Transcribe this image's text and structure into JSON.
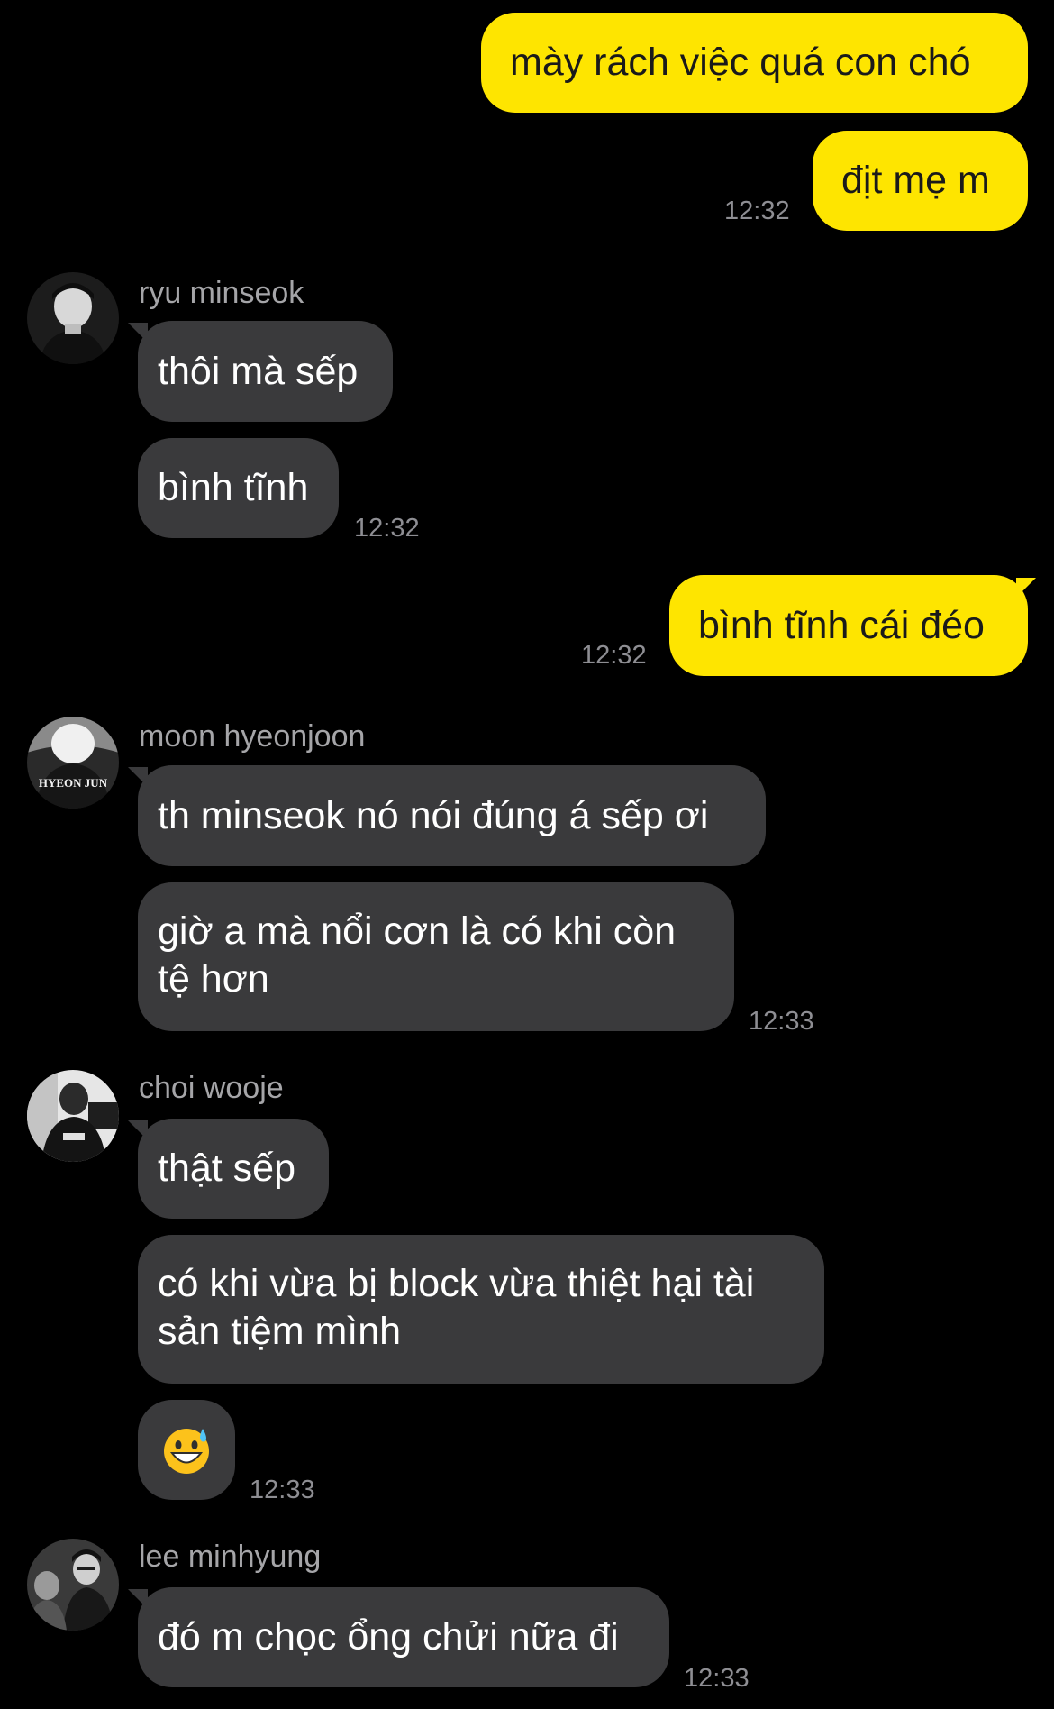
{
  "colors": {
    "background": "#000000",
    "outgoing_bubble": "#fee500",
    "incoming_bubble": "#3a3a3c",
    "timestamp": "#8e8e93",
    "sender_name": "#a5a5a8"
  },
  "messages": [
    {
      "id": "m1",
      "direction": "outgoing",
      "text": "mày rách việc quá con chó"
    },
    {
      "id": "m2",
      "direction": "outgoing",
      "text": "địt mẹ m",
      "time": "12:32"
    },
    {
      "sender": "ryu minseok",
      "avatar_icon": "avatar-ryu-minseok",
      "messages": [
        {
          "id": "m3",
          "text": "thôi mà sếp"
        },
        {
          "id": "m4",
          "text": "bình tĩnh",
          "time": "12:32"
        }
      ]
    },
    {
      "id": "m5",
      "direction": "outgoing",
      "text": "bình tĩnh cái đéo",
      "time": "12:32"
    },
    {
      "sender": "moon hyeonjoon",
      "avatar_icon": "avatar-moon-hyeonjoon",
      "avatar_text": "HYEON JUN",
      "messages": [
        {
          "id": "m6",
          "text": "th minseok nó nói đúng á sếp ơi"
        },
        {
          "id": "m7",
          "text": "giờ a mà nổi cơn là có khi còn tệ hơn",
          "time": "12:33"
        }
      ]
    },
    {
      "sender": "choi wooje",
      "avatar_icon": "avatar-choi-wooje",
      "messages": [
        {
          "id": "m8",
          "text": "thật sếp"
        },
        {
          "id": "m9",
          "text": "có khi vừa bị block vừa thiệt hại tài sản tiệm mình"
        },
        {
          "id": "m10",
          "emoji": "grinning-face-with-sweat-emoji",
          "time": "12:33"
        }
      ]
    },
    {
      "sender": "lee minhyung",
      "avatar_icon": "avatar-lee-minhyung",
      "messages": [
        {
          "id": "m11",
          "text": "đó m chọc ổng chửi nữa đi",
          "time": "12:33"
        }
      ]
    }
  ]
}
